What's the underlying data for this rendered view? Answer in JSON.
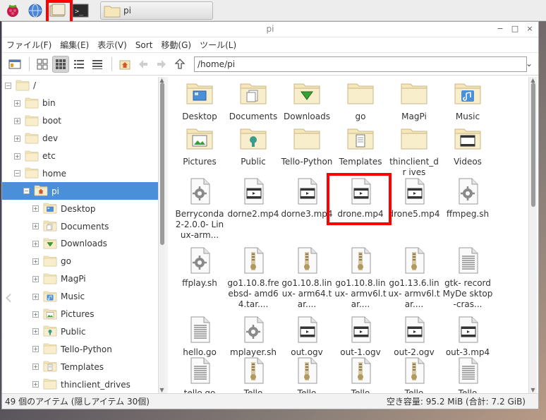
{
  "taskbar": {
    "task_label": "pi"
  },
  "window": {
    "title": "pi",
    "controls": [
      "−",
      "□",
      "×"
    ]
  },
  "menubar": [
    "ファイル(F)",
    "編集(E)",
    "表示(V)",
    "Sort",
    "移動(G)",
    "ツール(L)"
  ],
  "toolbar": {
    "path": "/home/pi"
  },
  "tree": [
    {
      "label": "/",
      "indent": 0,
      "exp": "−",
      "icon": "folder"
    },
    {
      "label": "bin",
      "indent": 1,
      "exp": "+",
      "icon": "folder"
    },
    {
      "label": "boot",
      "indent": 1,
      "exp": "+",
      "icon": "folder"
    },
    {
      "label": "dev",
      "indent": 1,
      "exp": "+",
      "icon": "folder"
    },
    {
      "label": "etc",
      "indent": 1,
      "exp": "+",
      "icon": "folder"
    },
    {
      "label": "home",
      "indent": 1,
      "exp": "−",
      "icon": "folder"
    },
    {
      "label": "pi",
      "indent": 2,
      "exp": "−",
      "icon": "home-folder",
      "selected": true
    },
    {
      "label": "Desktop",
      "indent": 3,
      "exp": "+",
      "icon": "desktop-folder"
    },
    {
      "label": "Documents",
      "indent": 3,
      "exp": "+",
      "icon": "documents-folder"
    },
    {
      "label": "Downloads",
      "indent": 3,
      "exp": "+",
      "icon": "downloads-folder"
    },
    {
      "label": "go",
      "indent": 3,
      "exp": "+",
      "icon": "folder"
    },
    {
      "label": "MagPi",
      "indent": 3,
      "exp": "+",
      "icon": "folder"
    },
    {
      "label": "Music",
      "indent": 3,
      "exp": "+",
      "icon": "music-folder"
    },
    {
      "label": "Pictures",
      "indent": 3,
      "exp": "+",
      "icon": "pictures-folder"
    },
    {
      "label": "Public",
      "indent": 3,
      "exp": "+",
      "icon": "public-folder"
    },
    {
      "label": "Tello-Python",
      "indent": 3,
      "exp": "+",
      "icon": "folder"
    },
    {
      "label": "Templates",
      "indent": 3,
      "exp": "+",
      "icon": "templates-folder"
    },
    {
      "label": "thinclient_drives",
      "indent": 3,
      "exp": "+",
      "icon": "folder"
    }
  ],
  "files": [
    {
      "name": "Desktop",
      "icon": "desktop-folder"
    },
    {
      "name": "Documents",
      "icon": "documents-folder"
    },
    {
      "name": "Downloads",
      "icon": "downloads-folder"
    },
    {
      "name": "go",
      "icon": "folder"
    },
    {
      "name": "MagPi",
      "icon": "folder"
    },
    {
      "name": "Music",
      "icon": "music-folder"
    },
    {
      "name": "Pictures",
      "icon": "pictures-folder"
    },
    {
      "name": "Public",
      "icon": "public-folder"
    },
    {
      "name": "Tello-Python",
      "icon": "folder"
    },
    {
      "name": "Templates",
      "icon": "templates-folder"
    },
    {
      "name": "thinclient_dr ives",
      "icon": "folder"
    },
    {
      "name": "Videos",
      "icon": "videos-folder"
    },
    {
      "name": "Berryconda 2-2.0.0- Linux-arm...",
      "icon": "script-file"
    },
    {
      "name": "dorne2.mp4",
      "icon": "video-file"
    },
    {
      "name": "dorne3.mp4",
      "icon": "video-file"
    },
    {
      "name": "drone.mp4",
      "icon": "video-file"
    },
    {
      "name": "drone5.mp4",
      "icon": "video-file"
    },
    {
      "name": "ffmpeg.sh",
      "icon": "script-file"
    },
    {
      "name": "ffplay.sh",
      "icon": "script-file"
    },
    {
      "name": "go1.10.8.fre ebsd- amd64.tar....",
      "icon": "archive-file"
    },
    {
      "name": "go1.10.8.lin ux- arm64.tar....",
      "icon": "archive-file"
    },
    {
      "name": "go1.10.8.lin ux- armv6l.tar....",
      "icon": "archive-file"
    },
    {
      "name": "go1.13.6.lin ux- armv6l.tar....",
      "icon": "archive-file"
    },
    {
      "name": "gtk- recordMyDe sktop-cras...",
      "icon": "text-file"
    },
    {
      "name": "hello.go",
      "icon": "text-file"
    },
    {
      "name": "mplayer.sh",
      "icon": "script-file"
    },
    {
      "name": "out.ogv",
      "icon": "video-file"
    },
    {
      "name": "out-1.ogv",
      "icon": "video-file"
    },
    {
      "name": "out-2.ogv",
      "icon": "video-file"
    },
    {
      "name": "out-3.mp4",
      "icon": "video-file"
    },
    {
      "name": "tello.go",
      "icon": "text-file"
    },
    {
      "name": "Tello",
      "icon": "archive-file"
    },
    {
      "name": "Tello",
      "icon": "archive-file"
    },
    {
      "name": "Tello",
      "icon": "archive-file"
    },
    {
      "name": "Tello",
      "icon": "archive-file"
    },
    {
      "name": "Tello",
      "icon": "text-file"
    }
  ],
  "status": {
    "left": "49 個のアイテム (隠しアイテム 30個)",
    "right": "空き容量: 95.2 MiB (合計: 7.2 GiB)"
  },
  "colors": {
    "selection": "#4a90d9",
    "highlight": "#ff0000",
    "folder": "#f5e7b8"
  }
}
